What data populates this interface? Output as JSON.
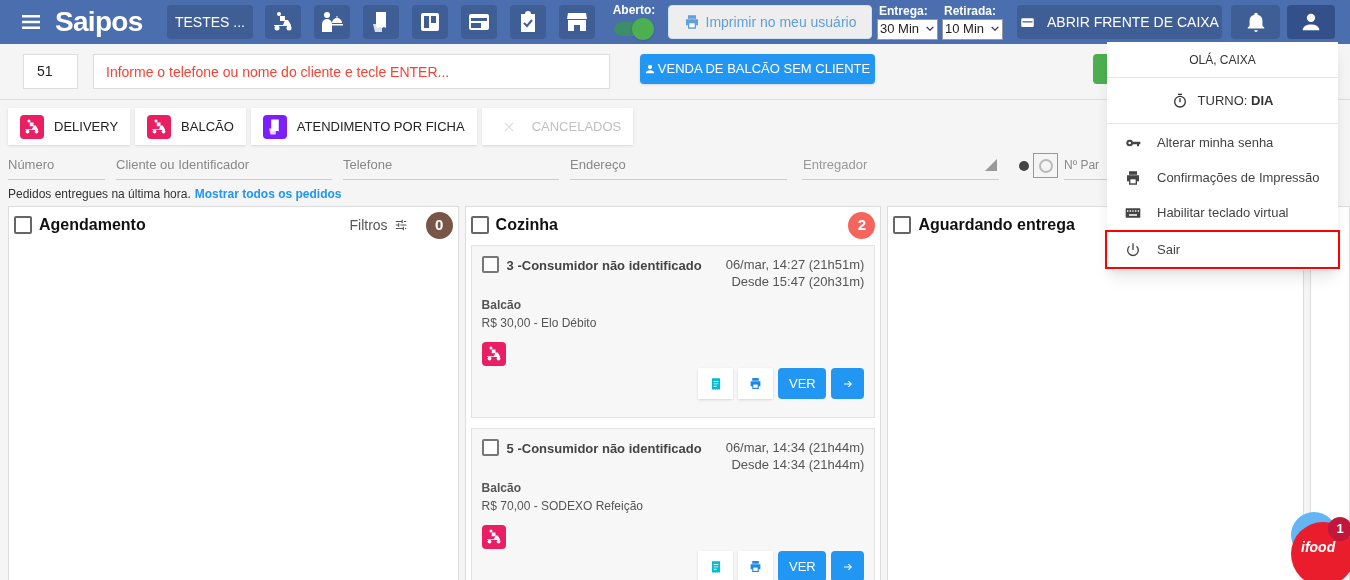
{
  "header": {
    "logo": "Saipos",
    "store": "TESTES ...",
    "open_toggle": {
      "label": "Aberto:",
      "on": true
    },
    "print_button": {
      "label": "Imprimir no meu usuário",
      "disabled": true
    },
    "delivery_time": {
      "label": "Entrega:",
      "value": "30 Min"
    },
    "pickup_time": {
      "label": "Retirada:",
      "value": "10 Min"
    },
    "cash_button": "ABRIR FRENTE DE CAIXA"
  },
  "search": {
    "number": "51",
    "placeholder": "Informe o telefone ou nome do cliente e tecle ENTER...",
    "counter_button": "VENDA DE BALCÃO SEM CLIENTE"
  },
  "tabs": [
    {
      "label": "DELIVERY",
      "color": "#e91e63",
      "disabled": false
    },
    {
      "label": "BALCÃO",
      "color": "#e91e63",
      "disabled": false
    },
    {
      "label": "ATENDIMENTO POR FICHA",
      "color": "#7c1fff",
      "disabled": false
    },
    {
      "label": "CANCELADOS",
      "disabled": true
    }
  ],
  "filters": [
    {
      "placeholder": "Número"
    },
    {
      "placeholder": "Cliente ou Identificador"
    },
    {
      "placeholder": "Telefone"
    },
    {
      "placeholder": "Endereço"
    },
    {
      "placeholder": "Entregador",
      "kind": "select"
    },
    {
      "placeholder": "Nº Par",
      "kind": "cut"
    }
  ],
  "info": {
    "text": "Pedidos entregues na última hora.",
    "link": "Mostrar todos os pedidos"
  },
  "columns": [
    {
      "title": "Agendamento",
      "checked": false,
      "filter_label": "Filtros",
      "count": "0",
      "color": "#795548"
    },
    {
      "title": "Cozinha",
      "checked": false,
      "count": "2",
      "color": "#f4665c",
      "orders": [
        {
          "title": "3 -Consumidor não identificado",
          "checked": false,
          "time": "06/mar, 14:27 (21h51m)",
          "since": "Desde 15:47 (20h31m)",
          "type": "Balcão",
          "payment": "R$ 30,00 - Elo Débito",
          "button": "VER"
        },
        {
          "title": "5 -Consumidor não identificado",
          "checked": false,
          "time": "06/mar, 14:34 (21h44m)",
          "since": "Desde 14:34 (21h44m)",
          "type": "Balcão",
          "payment": "R$ 70,00 - SODEXO Refeição",
          "button": "VER"
        }
      ]
    },
    {
      "title": "Aguardando entrega",
      "checked": false
    }
  ],
  "user_menu": {
    "greeting": "OLÁ, CAIXA",
    "shift_label": "TURNO:",
    "shift": "DIA",
    "items": [
      {
        "label": "Alterar minha senha",
        "kind": "key",
        "selected": false
      },
      {
        "label": "Confirmações de Impressão",
        "kind": "printer",
        "selected": false
      },
      {
        "label": "Habilitar teclado virtual",
        "kind": "keyboard",
        "selected": false
      },
      {
        "label": "Sair",
        "kind": "power",
        "selected": true
      }
    ]
  },
  "ifood": {
    "logo": "ifood",
    "badge": "1"
  }
}
